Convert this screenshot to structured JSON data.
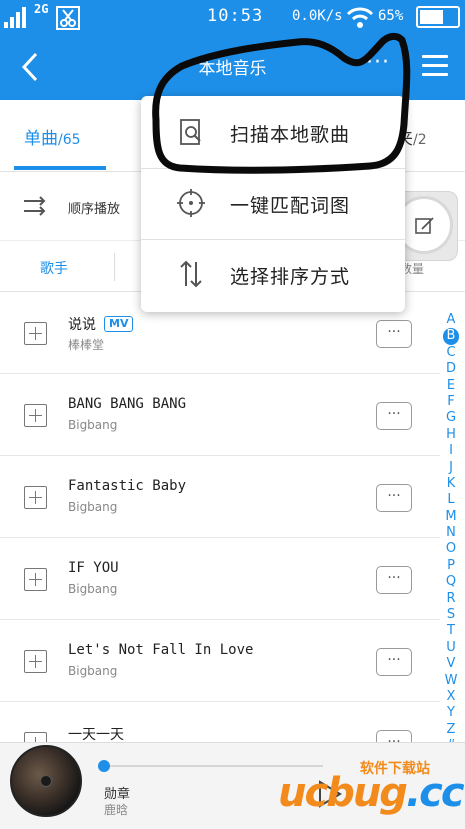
{
  "status_bar": {
    "network": "2G",
    "time": "10:53",
    "speed": "0.0K/s",
    "battery": "65%",
    "battery_level": 0.65
  },
  "header": {
    "title": "本地音乐",
    "more": "···"
  },
  "tabs": {
    "active_label": "单曲",
    "active_count": "/65",
    "right_label": "夹",
    "right_count": "/2"
  },
  "play_mode": {
    "label": "顺序播放"
  },
  "filters": {
    "artist": "歌手",
    "right": "数量"
  },
  "dropdown": {
    "items": [
      {
        "label": "扫描本地歌曲",
        "icon": "scan-file-icon"
      },
      {
        "label": "一键匹配词图",
        "icon": "crosshair-icon"
      },
      {
        "label": "选择排序方式",
        "icon": "sort-arrows-icon"
      }
    ]
  },
  "songs": [
    {
      "title": "说说",
      "artist": "棒棒堂",
      "mv": "MV"
    },
    {
      "title": "BANG BANG BANG",
      "artist": "Bigbang"
    },
    {
      "title": "Fantastic Baby",
      "artist": "Bigbang"
    },
    {
      "title": "IF YOU",
      "artist": "Bigbang"
    },
    {
      "title": "Let's Not Fall In Love",
      "artist": "Bigbang"
    },
    {
      "title": "一天一天",
      "artist": ""
    }
  ],
  "alphabet": [
    "A",
    "B",
    "C",
    "D",
    "E",
    "F",
    "G",
    "H",
    "I",
    "J",
    "K",
    "L",
    "M",
    "N",
    "O",
    "P",
    "Q",
    "R",
    "S",
    "T",
    "U",
    "V",
    "W",
    "X",
    "Y",
    "Z",
    "#"
  ],
  "alphabet_active": "B",
  "player": {
    "title": "勋章",
    "artist": "鹿晗",
    "progress": 0.0
  },
  "watermark": {
    "logo": "ucbug",
    "suffix": ".cc",
    "text": "软件下载站"
  },
  "colors": {
    "accent": "#1e8fe8",
    "watermark_orange": "#f28b1c"
  }
}
